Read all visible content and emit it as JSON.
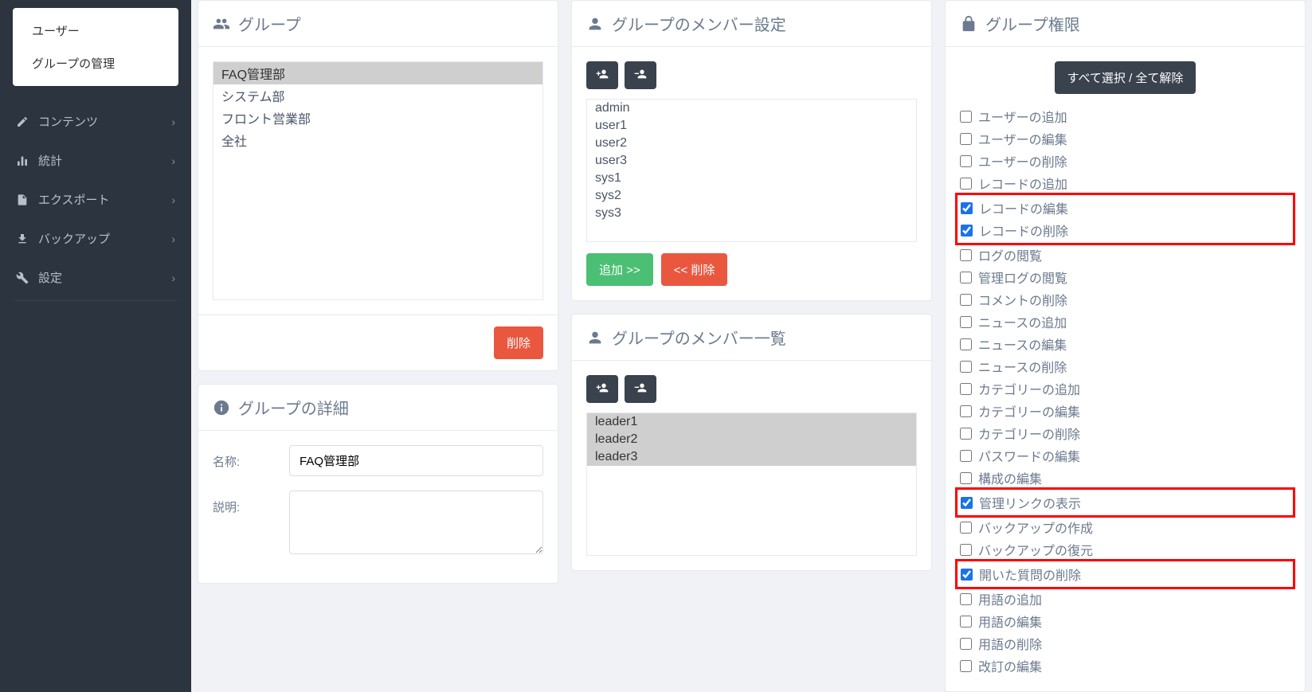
{
  "sidebar": {
    "submenu": [
      {
        "label": "ユーザー"
      },
      {
        "label": "グループの管理"
      }
    ],
    "nav": [
      {
        "label": "コンテンツ",
        "icon": "edit"
      },
      {
        "label": "統計",
        "icon": "stats"
      },
      {
        "label": "エクスポート",
        "icon": "file"
      },
      {
        "label": "バックアップ",
        "icon": "download"
      },
      {
        "label": "設定",
        "icon": "wrench"
      }
    ]
  },
  "groups_card": {
    "title": "グループ",
    "items": [
      "FAQ管理部",
      "システム部",
      "フロント営業部",
      "全社"
    ],
    "selected": 0,
    "delete_label": "削除"
  },
  "details_card": {
    "title": "グループの詳細",
    "name_label": "名称:",
    "name_value": "FAQ管理部",
    "desc_label": "説明:",
    "desc_value": ""
  },
  "members_set_card": {
    "title": "グループのメンバー設定",
    "users": [
      "admin",
      "user1",
      "user2",
      "user3",
      "sys1",
      "sys2",
      "sys3"
    ],
    "add_label": "追加 >>",
    "remove_label": "<< 削除"
  },
  "members_list_card": {
    "title": "グループのメンバー一覧",
    "members": [
      "leader1",
      "leader2",
      "leader3"
    ]
  },
  "perms_card": {
    "title": "グループ権限",
    "toggle_label": "すべて選択 / 全て解除",
    "items": [
      {
        "label": "ユーザーの追加",
        "checked": false,
        "hl": false
      },
      {
        "label": "ユーザーの編集",
        "checked": false,
        "hl": false
      },
      {
        "label": "ユーザーの削除",
        "checked": false,
        "hl": false
      },
      {
        "label": "レコードの追加",
        "checked": false,
        "hl": false
      },
      {
        "label": "レコードの編集",
        "checked": true,
        "hl": true,
        "hl_start": true
      },
      {
        "label": "レコードの削除",
        "checked": true,
        "hl": true,
        "hl_end": true
      },
      {
        "label": "ログの閲覧",
        "checked": false,
        "hl": false
      },
      {
        "label": "管理ログの閲覧",
        "checked": false,
        "hl": false
      },
      {
        "label": "コメントの削除",
        "checked": false,
        "hl": false
      },
      {
        "label": "ニュースの追加",
        "checked": false,
        "hl": false
      },
      {
        "label": "ニュースの編集",
        "checked": false,
        "hl": false
      },
      {
        "label": "ニュースの削除",
        "checked": false,
        "hl": false
      },
      {
        "label": "カテゴリーの追加",
        "checked": false,
        "hl": false
      },
      {
        "label": "カテゴリーの編集",
        "checked": false,
        "hl": false
      },
      {
        "label": "カテゴリーの削除",
        "checked": false,
        "hl": false
      },
      {
        "label": "パスワードの編集",
        "checked": false,
        "hl": false
      },
      {
        "label": "構成の編集",
        "checked": false,
        "hl": false
      },
      {
        "label": "管理リンクの表示",
        "checked": true,
        "hl": true,
        "hl_single": true
      },
      {
        "label": "バックアップの作成",
        "checked": false,
        "hl": false
      },
      {
        "label": "バックアップの復元",
        "checked": false,
        "hl": false
      },
      {
        "label": "開いた質問の削除",
        "checked": true,
        "hl": true,
        "hl_single": true
      },
      {
        "label": "用語の追加",
        "checked": false,
        "hl": false
      },
      {
        "label": "用語の編集",
        "checked": false,
        "hl": false
      },
      {
        "label": "用語の削除",
        "checked": false,
        "hl": false
      },
      {
        "label": "改訂の編集",
        "checked": false,
        "hl": false
      }
    ]
  }
}
